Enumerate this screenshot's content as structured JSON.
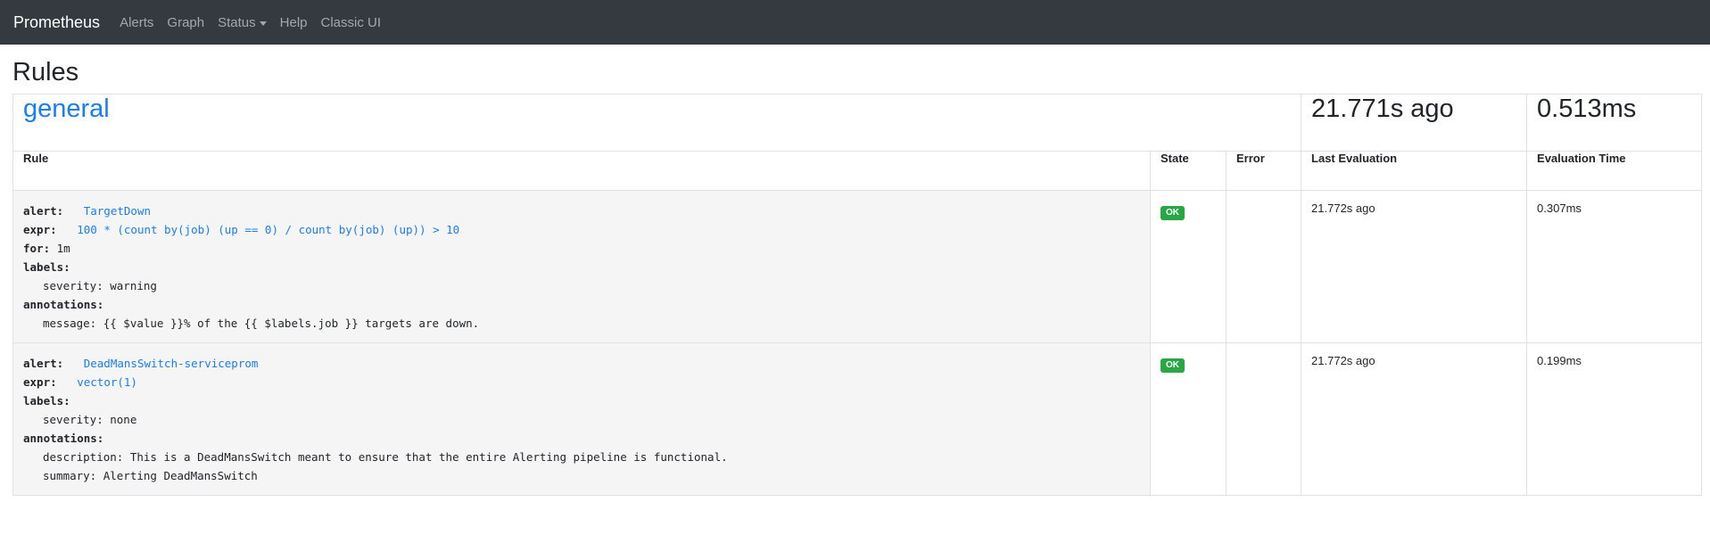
{
  "nav": {
    "brand": "Prometheus",
    "links": [
      "Alerts",
      "Graph",
      "Status",
      "Help",
      "Classic UI"
    ]
  },
  "page": {
    "title": "Rules"
  },
  "group": {
    "name": "general",
    "last_evaluation": "21.771s ago",
    "evaluation_time": "0.513ms"
  },
  "columns": [
    "Rule",
    "State",
    "Error",
    "Last Evaluation",
    "Evaluation Time"
  ],
  "rules": [
    {
      "alert_key": "alert:",
      "alert": "TargetDown",
      "expr_key": "expr:",
      "expr": "100 * (count by(job) (up == 0) / count by(job) (up)) > 10",
      "for_key": "for:",
      "for": "1m",
      "labels_key": "labels:",
      "label_line": "severity: warning",
      "annotations_key": "annotations:",
      "annotation_lines": [
        "message: {{ $value }}% of the {{ $labels.job }} targets are down."
      ],
      "state": "OK",
      "error": "",
      "last_evaluation": "21.772s ago",
      "evaluation_time": "0.307ms"
    },
    {
      "alert_key": "alert:",
      "alert": "DeadMansSwitch-serviceprom",
      "expr_key": "expr:",
      "expr": "vector(1)",
      "labels_key": "labels:",
      "label_line": "severity: none",
      "annotations_key": "annotations:",
      "annotation_lines": [
        "description: This is a DeadMansSwitch meant to ensure that the entire Alerting pipeline is functional.",
        "summary: Alerting DeadMansSwitch"
      ],
      "state": "OK",
      "error": "",
      "last_evaluation": "21.772s ago",
      "evaluation_time": "0.199ms"
    }
  ],
  "colors": {
    "navbar": "#343a40",
    "link": "#1a7df0",
    "ok": "#28a745"
  }
}
